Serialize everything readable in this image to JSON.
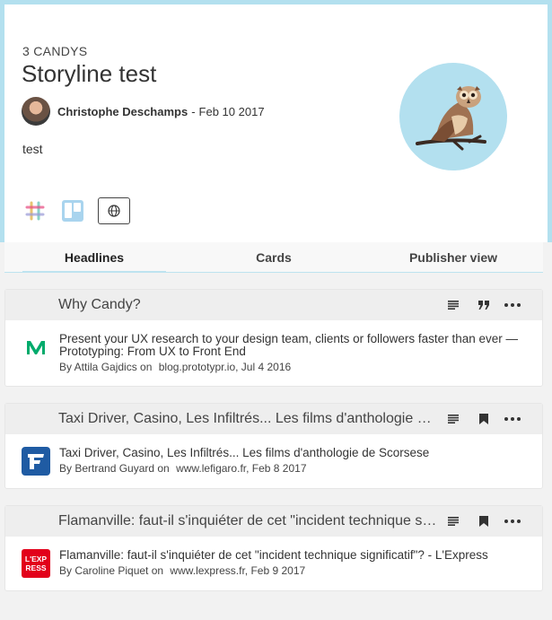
{
  "header": {
    "count": "3 CANDYS",
    "title": "Storyline test",
    "author": "Christophe Deschamps",
    "separator": "-",
    "date": "Feb 10 2017",
    "description": "test"
  },
  "share": [
    "slack-icon",
    "trello-icon",
    "globe-icon"
  ],
  "tabs": [
    {
      "label": "Headlines",
      "active": true
    },
    {
      "label": "Cards",
      "active": false
    },
    {
      "label": "Publisher view",
      "active": false
    }
  ],
  "stories": [
    {
      "header_title": "Why Candy?",
      "icon": "medium-icon",
      "title": "Present your UX research to your design team, clients or followers faster than ever — Prototyping: From UX to Front End",
      "by": "By Attila Gajdics on",
      "domain": "blog.prototypr.io",
      "date": ", Jul 4 2016",
      "actions": [
        "text-lines-icon",
        "quote-icon",
        "more-icon"
      ]
    },
    {
      "header_title": "Taxi Driver, Casino, Les Infiltrés... Les films d'anthologie de Scorsese",
      "icon": "lefigaro-icon",
      "title": "Taxi Driver, Casino, Les Infiltrés... Les films d'anthologie de Scorsese",
      "by": "By Bertrand Guyard on",
      "domain": "www.lefigaro.fr",
      "date": ", Feb 8 2017",
      "actions": [
        "text-lines-icon",
        "bookmark-icon",
        "more-icon"
      ]
    },
    {
      "header_title": "Flamanville: faut-il s'inquiéter de cet \"incident technique significatif\"? - L'Express",
      "icon": "lexpress-icon",
      "title": "Flamanville: faut-il s'inquiéter de cet \"incident technique significatif\"? - L'Express",
      "by": "By Caroline Piquet on",
      "domain": "www.lexpress.fr",
      "date": ", Feb 9 2017",
      "actions": [
        "text-lines-icon",
        "bookmark-icon",
        "more-icon"
      ],
      "logo_text": "L'EXPRESS"
    }
  ],
  "colors": {
    "accent": "#b3e0ef",
    "medium_green": "#00ab6c",
    "figaro_blue": "#1f5ba3",
    "express_red": "#e2001a"
  }
}
